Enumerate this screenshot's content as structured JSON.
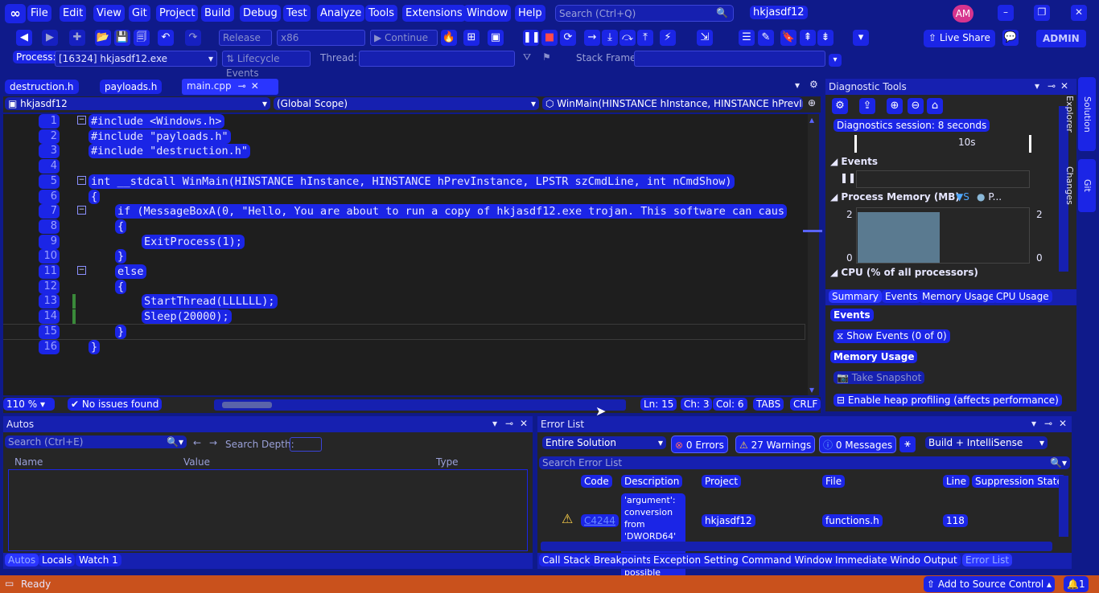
{
  "menu": [
    "File",
    "Edit",
    "View",
    "Git",
    "Project",
    "Build",
    "Debug",
    "Test",
    "Analyze",
    "Tools",
    "Extensions",
    "Window",
    "Help"
  ],
  "search_placeholder": "Search (Ctrl+Q)",
  "solution_name": "hkjasdf12",
  "user_initials": "AM",
  "toolbar": {
    "config": "Release",
    "platform": "x86",
    "continue_label": "Continue",
    "live_share": "Live Share",
    "admin": "ADMIN"
  },
  "debugbar": {
    "process_label": "Process:",
    "process_value": "[16324] hkjasdf12.exe",
    "lifecycle": "Lifecycle Events",
    "thread_label": "Thread:",
    "stack_label": "Stack Frame:"
  },
  "editor": {
    "tabs": [
      "destruction.h",
      "payloads.h",
      "main.cpp"
    ],
    "nav_project": "hkjasdf12",
    "nav_scope": "(Global Scope)",
    "nav_function": "WinMain(HINSTANCE hInstance, HINSTANCE hPrevInsta",
    "lines": [
      {
        "n": "1",
        "text": "#include <Windows.h>"
      },
      {
        "n": "2",
        "text": "#include \"payloads.h\""
      },
      {
        "n": "3",
        "text": "#include \"destruction.h\""
      },
      {
        "n": "4",
        "text": ""
      },
      {
        "n": "5",
        "text": "int __stdcall WinMain(HINSTANCE hInstance, HINSTANCE hPrevInstance, LPSTR szCmdLine, int nCmdShow)"
      },
      {
        "n": "6",
        "text": "{"
      },
      {
        "n": "7",
        "text": "if (MessageBoxA(0, \"Hello, You are about to run a copy of hkjasdf12.exe trojan. This software can caus"
      },
      {
        "n": "8",
        "text": "{"
      },
      {
        "n": "9",
        "text": "ExitProcess(1);"
      },
      {
        "n": "10",
        "text": "}"
      },
      {
        "n": "11",
        "text": "else"
      },
      {
        "n": "12",
        "text": "{"
      },
      {
        "n": "13",
        "text": "StartThread(LLLLLL);"
      },
      {
        "n": "14",
        "text": "Sleep(20000);"
      },
      {
        "n": "15",
        "text": "}"
      },
      {
        "n": "16",
        "text": "}"
      }
    ],
    "zoom": "110 %",
    "issues": "No issues found",
    "ln": "Ln: 15",
    "ch": "Ch: 3",
    "col": "Col: 6",
    "tabs_mode": "TABS",
    "eol": "CRLF"
  },
  "diagnostics": {
    "title": "Diagnostic Tools",
    "session": "Diagnostics session: 8 seconds",
    "tick": "10s",
    "events": "Events",
    "memory_title": "Process Memory (MB)",
    "legend_s": "S",
    "legend_p": "P...",
    "mem_max": "2",
    "mem_min": "0",
    "memory_level": 0.92,
    "cpu_title": "CPU (% of all processors)",
    "tabs": [
      "Summary",
      "Events",
      "Memory Usage",
      "CPU Usage"
    ],
    "section_events": "Events",
    "show_events": "Show Events (0 of 0)",
    "section_memory": "Memory Usage",
    "take_snapshot": "Take Snapshot",
    "heap_profiling": "Enable heap profiling (affects performance)"
  },
  "autos": {
    "title": "Autos",
    "search_placeholder": "Search (Ctrl+E)",
    "search_depth": "Search Depth:",
    "columns": [
      "Name",
      "Value",
      "Type"
    ],
    "bottom_tabs": [
      "Autos",
      "Locals",
      "Watch 1"
    ]
  },
  "errorlist": {
    "title": "Error List",
    "scope": "Entire Solution",
    "errors": "0 Errors",
    "warnings": "27 Warnings",
    "messages": "0 Messages",
    "build_filter": "Build + IntelliSense",
    "search_placeholder": "Search Error List",
    "columns": [
      "Code",
      "Description",
      "Project",
      "File",
      "Line",
      "Suppression State"
    ],
    "row": {
      "code": "C4244",
      "description": [
        "'argument':",
        "conversion from",
        "'DWORD64' to",
        "'DWORD', possible"
      ],
      "project": "hkjasdf12",
      "file": "functions.h",
      "line": "118"
    },
    "bottom_tabs": [
      "Call Stack",
      "Breakpoints",
      "Exception Settings",
      "Command Window",
      "Immediate Window",
      "Output",
      "Error List"
    ]
  },
  "status": {
    "ready": "Ready",
    "source_control": "Add to Source Control",
    "notifications": "1"
  }
}
